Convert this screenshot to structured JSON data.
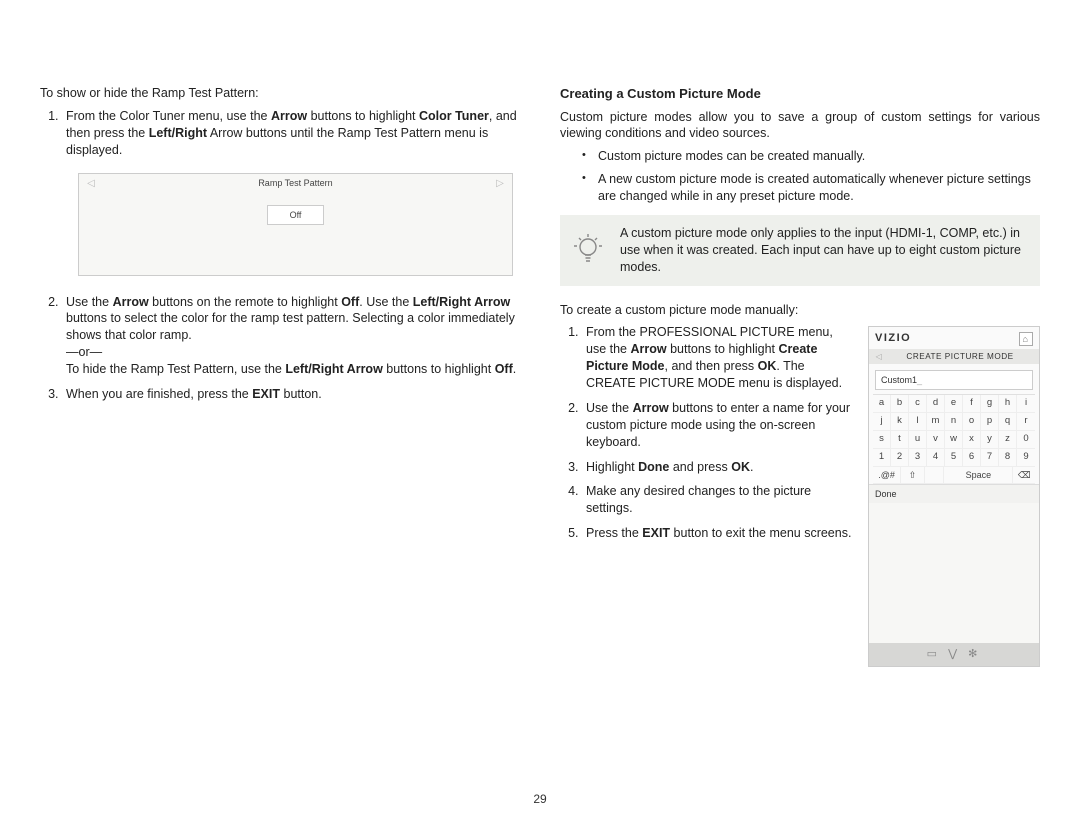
{
  "page_number": "29",
  "left": {
    "intro": "To show or hide the Ramp Test Pattern:",
    "step1_pre": "From the Color Tuner menu, use the ",
    "arrow": "Arrow",
    "step1_mid1": " buttons to highlight ",
    "color_tuner": "Color Tuner",
    "step1_mid2": ", and then press the ",
    "leftright": "Left/Right",
    "step1_post": " Arrow buttons until the Ramp Test Pattern menu is displayed.",
    "ramp_title": "Ramp Test Pattern",
    "ramp_off": "Off",
    "step2_pre": "Use the ",
    "step2_mid1": " buttons on the remote to highlight ",
    "off_bold": "Off",
    "step2_mid2": ". Use the ",
    "leftright_arrow": "Left/Right Arrow",
    "step2_post": " buttons to select the color for the ramp test pattern. Selecting a color immediately shows that color ramp.",
    "or": "—or—",
    "hide_pre": "To hide the Ramp Test Pattern, use the ",
    "hide_post": " buttons to highlight ",
    "hide_off": "Off",
    "step3_pre": "When you are finished, press the ",
    "exit": "EXIT",
    "step3_post": " button."
  },
  "right": {
    "heading": "Creating a Custom Picture Mode",
    "intro": "Custom picture modes allow you to save a group of custom settings for various viewing conditions and video sources.",
    "bullet1": "Custom picture modes can be created manually.",
    "bullet2": "A new custom picture mode is created automatically whenever picture settings are changed while in any preset picture mode.",
    "tip": "A custom picture mode only applies to the input (HDMI-1, COMP, etc.) in use when it was created. Each input can have up to eight custom picture modes.",
    "create_intro": "To create a custom picture mode manually:",
    "s1_a": "From the PROFESSIONAL PICTURE menu, use the ",
    "arrow": "Arrow",
    "s1_b": " buttons to highlight ",
    "create_pm": "Create Picture Mode",
    "s1_c": ", and then press ",
    "ok": "OK",
    "s1_d": ". The CREATE PICTURE MODE menu is displayed.",
    "s2_a": "Use the ",
    "s2_b": " buttons to enter a name for your custom picture mode using the on-screen keyboard.",
    "s3_a": "Highlight ",
    "done": "Done",
    "s3_b": " and press ",
    "s4": "Make any desired changes to the picture settings.",
    "s5_a": "Press the ",
    "exit": "EXIT",
    "s5_b": " button to exit the menu screens."
  },
  "device": {
    "brand": "VIZIO",
    "subtitle": "CREATE PICTURE MODE",
    "input_value": "Custom1",
    "rows": [
      [
        "a",
        "b",
        "c",
        "d",
        "e",
        "f",
        "g",
        "h",
        "i"
      ],
      [
        "j",
        "k",
        "l",
        "m",
        "n",
        "o",
        "p",
        "q",
        "r"
      ],
      [
        "s",
        "t",
        "u",
        "v",
        "w",
        "x",
        "y",
        "z",
        "0"
      ],
      [
        "1",
        "2",
        "3",
        "4",
        "5",
        "6",
        "7",
        "8",
        "9"
      ]
    ],
    "fn": {
      "sym": ".@#",
      "shift": "⇧",
      "blank": "",
      "space": "Space",
      "del": "⌫"
    },
    "done": "Done",
    "footer_icons": "▭  ⋁  ✻"
  }
}
